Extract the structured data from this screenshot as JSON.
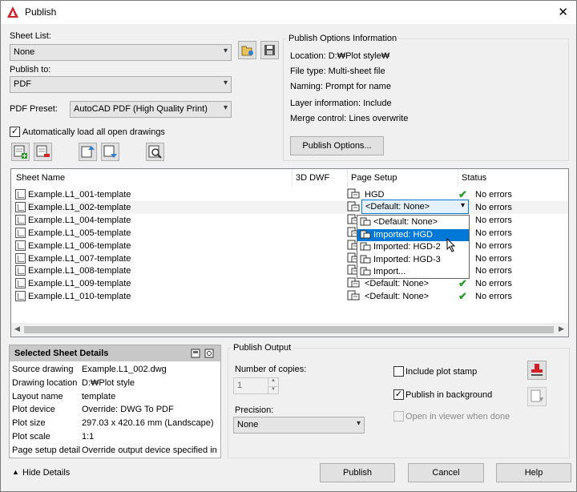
{
  "window": {
    "title": "Publish",
    "close_glyph": "✕"
  },
  "sheet_list": {
    "label": "Sheet List:",
    "value": "None"
  },
  "publish_to": {
    "label": "Publish to:",
    "value": "PDF"
  },
  "pdf_preset": {
    "label": "PDF Preset:",
    "value": "AutoCAD PDF (High Quality Print)"
  },
  "auto_load": {
    "label": "Automatically load all open drawings",
    "checked": true,
    "mark": "✓"
  },
  "info": {
    "group_title": "Publish Options Information",
    "location": "Location: D:₩Plot style₩",
    "file_type": "File type: Multi-sheet file",
    "naming": "Naming: Prompt for name",
    "layer": "Layer information: Include",
    "merge": "Merge control: Lines overwrite",
    "options_button": "Publish Options..."
  },
  "table": {
    "headers": {
      "sheet_name": "Sheet Name",
      "dwf3d": "3D DWF",
      "page_setup": "Page Setup",
      "status": "Status"
    },
    "rows": [
      {
        "name": "Example.L1_001-template",
        "page_setup": "HGD",
        "status": "No errors"
      },
      {
        "name": "Example.L1_002-template",
        "page_setup": "<Default: None>",
        "status": "No errors"
      },
      {
        "name": "Example.L1_004-template",
        "page_setup": "",
        "status": "No errors"
      },
      {
        "name": "Example.L1_005-template",
        "page_setup": "",
        "status": "No errors"
      },
      {
        "name": "Example.L1_006-template",
        "page_setup": "",
        "status": "No errors"
      },
      {
        "name": "Example.L1_007-template",
        "page_setup": "",
        "status": "No errors"
      },
      {
        "name": "Example.L1_008-template",
        "page_setup": "<Default: None>",
        "status": "No errors"
      },
      {
        "name": "Example.L1_009-template",
        "page_setup": "<Default: None>",
        "status": "No errors"
      },
      {
        "name": "Example.L1_010-template",
        "page_setup": "<Default: None>",
        "status": "No errors"
      }
    ],
    "dropdown": {
      "selected": "<Default: None>",
      "options": [
        "<Default: None>",
        "Imported: HGD",
        "Imported: HGD-2",
        "Imported: HGD-3",
        "Import..."
      ],
      "highlighted": "Imported: HGD"
    },
    "ok_glyph": "✔"
  },
  "details": {
    "title": "Selected Sheet Details",
    "rows": [
      {
        "key": "Source drawing",
        "value": "Example.L1_002.dwg"
      },
      {
        "key": "Drawing location",
        "value": "D:₩Plot style"
      },
      {
        "key": "Layout name",
        "value": "template"
      },
      {
        "key": "Plot device",
        "value": "Override: DWG To PDF"
      },
      {
        "key": "Plot size",
        "value": "297.03 x 420.16 mm (Landscape)"
      },
      {
        "key": "Plot scale",
        "value": "1:1"
      },
      {
        "key": "Page setup detail",
        "value": "Override output device specified in ..."
      }
    ]
  },
  "output": {
    "group_title": "Publish Output",
    "copies_label": "Number of copies:",
    "copies_value": "1",
    "precision_label": "Precision:",
    "precision_value": "None",
    "include_plot_stamp": {
      "label": "Include plot stamp",
      "checked": false
    },
    "publish_background": {
      "label": "Publish in background",
      "checked": true,
      "mark": "✓"
    },
    "open_viewer": {
      "label": "Open in viewer when done",
      "checked": false,
      "disabled": true
    }
  },
  "footer": {
    "hide_details": "Hide Details",
    "hide_glyph": "▲",
    "publish": "Publish",
    "cancel": "Cancel",
    "help": "Help"
  },
  "colors": {
    "accent": "#0078d7",
    "ok_green": "#2a9d2a",
    "autocad_red": "#d31f26"
  }
}
